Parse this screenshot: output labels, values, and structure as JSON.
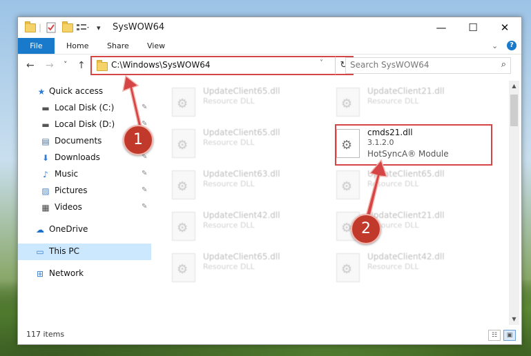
{
  "window": {
    "title": "SysWOW64",
    "minimize": "—",
    "maximize": "☐",
    "close": "✕"
  },
  "quick_access_toolbar": {
    "dropdown": "▾"
  },
  "ribbon": {
    "file_tab": "File",
    "tabs": [
      "Home",
      "Share",
      "View"
    ],
    "expand": "⌄",
    "help": "?"
  },
  "address_bar": {
    "back": "←",
    "forward": "→",
    "recent": "˅",
    "up": "↑",
    "path": "C:\\Windows\\SysWOW64",
    "dropdown": "˅",
    "refresh": "↻"
  },
  "search": {
    "placeholder": "Search SysWOW64",
    "icon": "⌕"
  },
  "sidebar": {
    "items": [
      {
        "label": "Quick access",
        "icon": "★",
        "icon_color": "#2c7bd6"
      },
      {
        "label": "Local Disk (C:)",
        "icon": "▬",
        "icon_color": "#555555"
      },
      {
        "label": "Local Disk (D:)",
        "icon": "▬",
        "icon_color": "#555555"
      },
      {
        "label": "Documents",
        "icon": "▤",
        "icon_color": "#4b6f9c"
      },
      {
        "label": "Downloads",
        "icon": "⬇",
        "icon_color": "#2f7fd8"
      },
      {
        "label": "Music",
        "icon": "♪",
        "icon_color": "#2f7fd8"
      },
      {
        "label": "Pictures",
        "icon": "▨",
        "icon_color": "#4b86c2"
      },
      {
        "label": "Videos",
        "icon": "▦",
        "icon_color": "#444444"
      },
      {
        "label": "OneDrive",
        "icon": "☁",
        "icon_color": "#1c6fc9"
      },
      {
        "label": "This PC",
        "icon": "▭",
        "icon_color": "#3a7fcf"
      },
      {
        "label": "Network",
        "icon": "⊞",
        "icon_color": "#3a7fcf"
      }
    ],
    "pin": "📌"
  },
  "files": [
    {
      "name": "UpdateClient65.dll",
      "type": "Resource DLL"
    },
    {
      "name": "UpdateClient21.dll",
      "type": "Resource DLL"
    },
    {
      "name": "UpdateClient65.dll",
      "type": "Resource DLL"
    },
    {
      "name": "cmds21.dll",
      "type": "3.1.2.0",
      "desc": "HotSyncA® Module"
    },
    {
      "name": "UpdateClient63.dll",
      "type": "Resource DLL"
    },
    {
      "name": "UpdateClient65.dll",
      "type": "Resource DLL"
    },
    {
      "name": "UpdateClient42.dll",
      "type": "Resource DLL"
    },
    {
      "name": "UpdateClient21.dll",
      "type": "Resource DLL"
    },
    {
      "name": "UpdateClient65.dll",
      "type": "Resource DLL"
    },
    {
      "name": "UpdateClient42.dll",
      "type": "Resource DLL"
    }
  ],
  "callouts": [
    "1",
    "2"
  ],
  "status": {
    "count": "117 items"
  },
  "view_buttons": {
    "details": "☷",
    "large_icons": "▣"
  },
  "scroll": {
    "up": "▲",
    "down": "▼"
  }
}
